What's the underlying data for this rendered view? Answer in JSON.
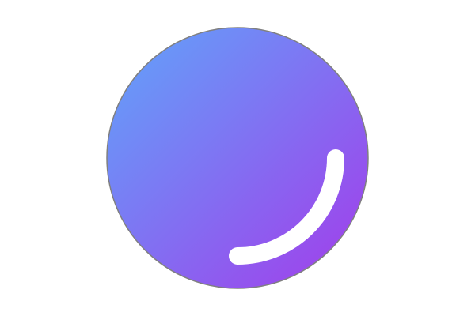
{
  "icon": {
    "name": "gradient-orb-icon",
    "colors": {
      "gradient_start": "#60A5FA",
      "gradient_end": "#A33BEA",
      "highlight": "#FFFFFF",
      "outline": "#808080",
      "background": "#FFFFFF"
    }
  }
}
